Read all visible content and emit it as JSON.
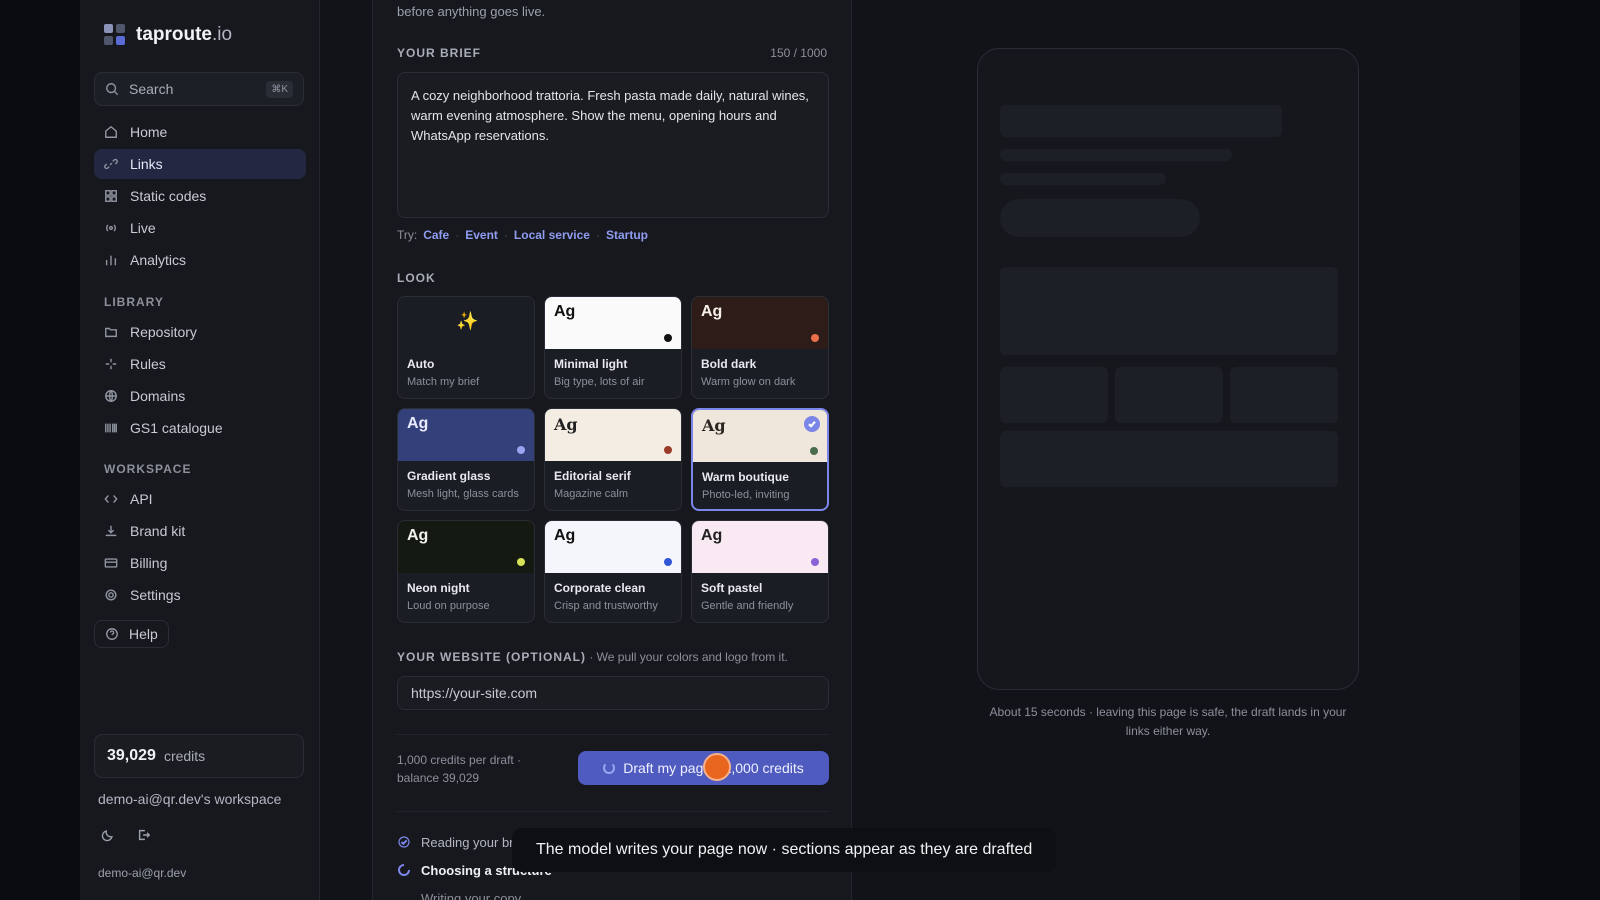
{
  "brand": {
    "name": "taproute",
    "tld": ".io"
  },
  "search": {
    "placeholder": "Search",
    "shortcut": "⌘K"
  },
  "nav_main": [
    {
      "label": "Home",
      "icon": "home-icon"
    },
    {
      "label": "Links",
      "icon": "link-icon",
      "active": true
    },
    {
      "label": "Static codes",
      "icon": "grid-icon"
    },
    {
      "label": "Live",
      "icon": "broadcast-icon"
    },
    {
      "label": "Analytics",
      "icon": "bar-chart-icon"
    }
  ],
  "library": {
    "title": "LIBRARY",
    "items": [
      {
        "label": "Repository",
        "icon": "folder-icon"
      },
      {
        "label": "Rules",
        "icon": "sparkle-icon"
      },
      {
        "label": "Domains",
        "icon": "globe-icon"
      },
      {
        "label": "GS1 catalogue",
        "icon": "barcode-icon"
      }
    ]
  },
  "workspace_nav": {
    "title": "WORKSPACE",
    "items": [
      {
        "label": "API",
        "icon": "code-icon"
      },
      {
        "label": "Brand kit",
        "icon": "download-icon"
      },
      {
        "label": "Billing",
        "icon": "card-icon"
      },
      {
        "label": "Settings",
        "icon": "gear-icon"
      }
    ]
  },
  "help": {
    "label": "Help"
  },
  "credits": {
    "amount": "39,029",
    "label": "credits"
  },
  "workspace": {
    "name": "demo-ai@qr.dev's workspace",
    "email": "demo-ai@qr.dev"
  },
  "main": {
    "intro": "before anything goes live.",
    "brief": {
      "label": "YOUR BRIEF",
      "counter": "150 / 1000",
      "value": "A cozy neighborhood trattoria. Fresh pasta made daily, natural wines, warm evening atmosphere. Show the menu, opening hours and WhatsApp reservations."
    },
    "try": {
      "label": "Try:",
      "options": [
        "Cafe",
        "Event",
        "Local service",
        "Startup"
      ]
    },
    "look": {
      "label": "LOOK",
      "cards": [
        {
          "name": "Auto",
          "desc": "Match my brief",
          "sample": "✨",
          "bg": "#1b1d24",
          "fg": "#f3c64a",
          "accent": ""
        },
        {
          "name": "Minimal light",
          "desc": "Big type, lots of air",
          "sample": "Ag",
          "bg": "#fafafa",
          "fg": "#111111",
          "accent": "#111111"
        },
        {
          "name": "Bold dark",
          "desc": "Warm glow on dark",
          "sample": "Ag",
          "bg": "#2e1c19",
          "fg": "#f5f0ea",
          "accent": "#e8704a"
        },
        {
          "name": "Gradient glass",
          "desc": "Mesh light, glass cards",
          "sample": "Ag",
          "bg": "#34407a",
          "fg": "#e8eaff",
          "accent": "#9aa4f0"
        },
        {
          "name": "Editorial serif",
          "desc": "Magazine calm",
          "sample": "Ag",
          "bg": "#f3ede3",
          "fg": "#222222",
          "accent": "#9a3b2a",
          "serif": true
        },
        {
          "name": "Warm boutique",
          "desc": "Photo-led, inviting",
          "sample": "Ag",
          "bg": "#efe6dc",
          "fg": "#2a2520",
          "accent": "#4a6b4e",
          "serif": true,
          "selected": true
        },
        {
          "name": "Neon night",
          "desc": "Loud on purpose",
          "sample": "Ag",
          "bg": "#141a12",
          "fg": "#f1f2ec",
          "accent": "#d7e356"
        },
        {
          "name": "Corporate clean",
          "desc": "Crisp and trustworthy",
          "sample": "Ag",
          "bg": "#f4f6fb",
          "fg": "#111111",
          "accent": "#2f56d6"
        },
        {
          "name": "Soft pastel",
          "desc": "Gentle and friendly",
          "sample": "Ag",
          "bg": "#f8e9f2",
          "fg": "#222222",
          "accent": "#8a62d6"
        }
      ]
    },
    "website": {
      "label": "YOUR WEBSITE (OPTIONAL)",
      "hint": "· We pull your colors and logo from it.",
      "placeholder": "https://your-site.com"
    },
    "pricing": {
      "note_line1": "1,000 credits per draft ·",
      "note_line2": "balance 39,029",
      "button": "Draft my page · 1,000 credits"
    },
    "steps": [
      {
        "label": "Reading your brief",
        "state": "done"
      },
      {
        "label": "Choosing a structure",
        "state": "active"
      },
      {
        "label": "Writing your copy",
        "state": "pending"
      }
    ]
  },
  "preview": {
    "note": "About 15 seconds · leaving this page is safe, the draft lands in your links either way."
  },
  "caption": "The model writes your page now · sections appear as they are drafted",
  "colors": {
    "accent": "#7c86e8",
    "button": "#4f5bbf",
    "background": "#111318"
  }
}
